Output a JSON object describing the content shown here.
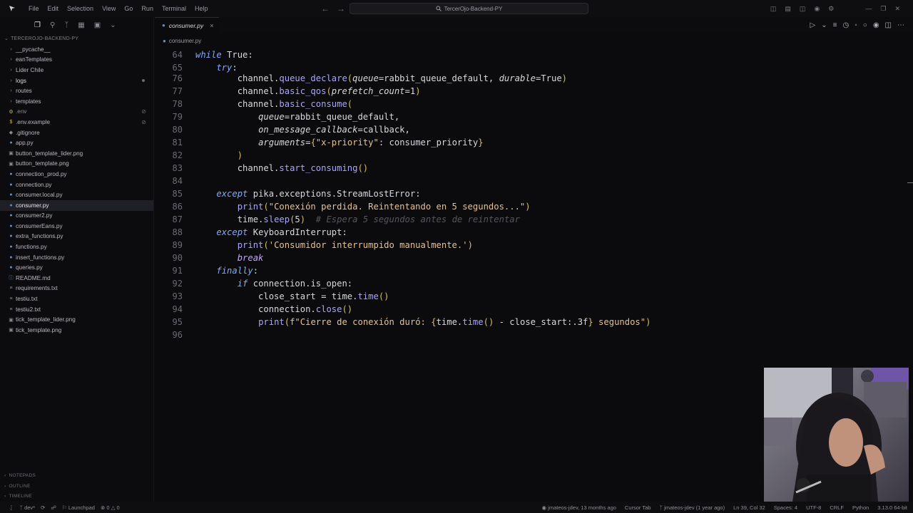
{
  "menu": [
    "File",
    "Edit",
    "Selection",
    "View",
    "Go",
    "Run",
    "Terminal",
    "Help"
  ],
  "command_center": "TercerOjo-Backend-PY",
  "explorer": {
    "title": "TERCEROJO-BACKEND-PY",
    "items": [
      {
        "label": "__pycache__",
        "type": "folder"
      },
      {
        "label": "eanTemplates",
        "type": "folder"
      },
      {
        "label": "Lider Chile",
        "type": "folder"
      },
      {
        "label": "logs",
        "type": "folder"
      },
      {
        "label": "routes",
        "type": "folder"
      },
      {
        "label": "templates",
        "type": "folder"
      },
      {
        "label": ".env",
        "type": "file"
      },
      {
        "label": ".env.example",
        "type": "file"
      },
      {
        "label": ".gitignore",
        "type": "file"
      },
      {
        "label": "app.py",
        "type": "file"
      },
      {
        "label": "button_template_lider.png",
        "type": "file"
      },
      {
        "label": "button_template.png",
        "type": "file"
      },
      {
        "label": "connection_prod.py",
        "type": "file"
      },
      {
        "label": "connection.py",
        "type": "file"
      },
      {
        "label": "consumer.local.py",
        "type": "file"
      },
      {
        "label": "consumer.py",
        "type": "file"
      },
      {
        "label": "consumer2.py",
        "type": "file"
      },
      {
        "label": "consumerEans.py",
        "type": "file"
      },
      {
        "label": "extra_functions.py",
        "type": "file"
      },
      {
        "label": "functions.py",
        "type": "file"
      },
      {
        "label": "insert_functions.py",
        "type": "file"
      },
      {
        "label": "queries.py",
        "type": "file"
      },
      {
        "label": "README.md",
        "type": "file"
      },
      {
        "label": "requirements.txt",
        "type": "file"
      },
      {
        "label": "testiu.txt",
        "type": "file"
      },
      {
        "label": "testiu2.txt",
        "type": "file"
      },
      {
        "label": "tick_template_lider.png",
        "type": "file"
      },
      {
        "label": "tick_template.png",
        "type": "file"
      }
    ],
    "sections": [
      "NOTEPADS",
      "OUTLINE",
      "TIMELINE"
    ]
  },
  "tab": {
    "label": "consumer.py",
    "close": "×"
  },
  "breadcrumb": "consumer.py",
  "code_lines": [
    "64",
    "65",
    "76",
    "77",
    "78",
    "79",
    "80",
    "81",
    "82",
    "83",
    "84",
    "85",
    "86",
    "87",
    "88",
    "89",
    "90",
    "91",
    "92",
    "93",
    "94",
    "95",
    "96"
  ],
  "statusbar": {
    "branch": "dev*",
    "launchpad": "Launchpad",
    "problems": "0",
    "warnings": "0",
    "blame": "jmateos-jdev, 13 months ago",
    "cursor_tab": "Cursor Tab",
    "blame2": "jmateos-jdev (1 year ago)",
    "position": "Ln 39, Col 32",
    "spaces": "Spaces: 4",
    "encoding": "UTF-8",
    "eol": "CRLF",
    "language": "Python",
    "version": "3.13.0 64-bit"
  }
}
